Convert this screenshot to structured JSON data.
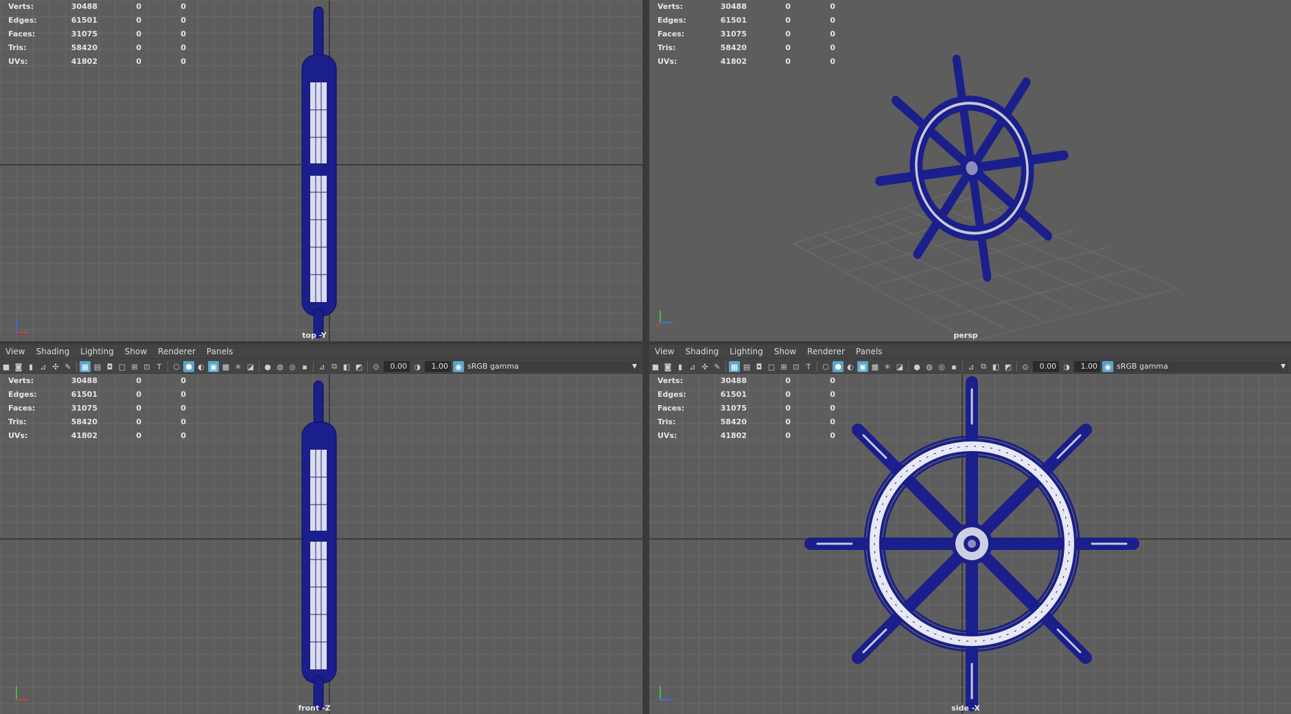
{
  "stats": {
    "rows": [
      {
        "label": "Verts:",
        "v1": "30488",
        "v2": "0",
        "v3": "0"
      },
      {
        "label": "Edges:",
        "v1": "61501",
        "v2": "0",
        "v3": "0"
      },
      {
        "label": "Faces:",
        "v1": "31075",
        "v2": "0",
        "v3": "0"
      },
      {
        "label": "Tris:",
        "v1": "58420",
        "v2": "0",
        "v3": "0"
      },
      {
        "label": "UVs:",
        "v1": "41802",
        "v2": "0",
        "v3": "0"
      }
    ]
  },
  "viewports": {
    "top": {
      "camera": "top -Y"
    },
    "persp": {
      "camera": "persp"
    },
    "front": {
      "camera": "front -Z"
    },
    "side": {
      "camera": "side -X"
    }
  },
  "menu": [
    "View",
    "Shading",
    "Lighting",
    "Show",
    "Renderer",
    "Panels"
  ],
  "toolbar": {
    "exposure": "0.00",
    "gamma": "1.00",
    "color_space": "sRGB gamma",
    "icons": [
      "camera-icon",
      "camera-attr-icon",
      "bookmark-icon",
      "image-plane-icon",
      "grid-icon",
      "film-gate-icon",
      "resolution-gate-icon",
      "wireframe-icon",
      "smooth-shade-icon",
      "textured-icon",
      "lights-icon",
      "shadows-icon",
      "isolate-icon",
      "xray-icon"
    ]
  },
  "colors": {
    "viewport_bg": "#5d5d5d",
    "grid": "#6a6a6a",
    "mesh": "#1a1f8c",
    "mesh_highlight": "#e8e8f4",
    "accent": "#5ba5c9"
  }
}
